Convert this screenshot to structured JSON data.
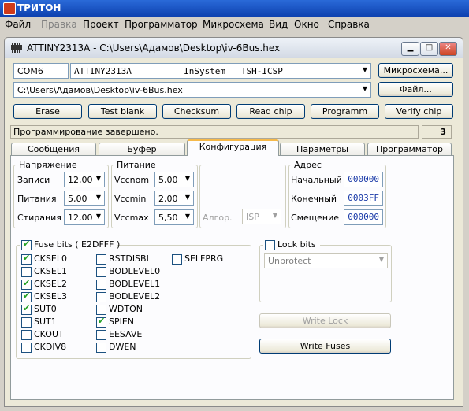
{
  "app": {
    "title": "ТРИТОН"
  },
  "menu": [
    {
      "label": "Файл",
      "disabled": false
    },
    {
      "label": "Правка",
      "disabled": true
    },
    {
      "label": "Проект",
      "disabled": false
    },
    {
      "label": "Программатор",
      "disabled": false
    },
    {
      "label": "Микросхема",
      "disabled": false
    },
    {
      "label": "Вид",
      "disabled": false
    },
    {
      "label": "Окно",
      "disabled": false
    },
    {
      "label": "Справка",
      "disabled": false
    }
  ],
  "window": {
    "title": "ATTINY2313A - C:\\Users\\Адамов\\Desktop\\iv-6Bus.hex"
  },
  "selectors": {
    "port": "COM6",
    "chip_info": "ATTINY2313A          InSystem   TSH-ICSP",
    "file_path": "C:\\Users\\Адамов\\Desktop\\iv-6Bus.hex",
    "chip_button": "Микросхема...",
    "file_button": "Файл..."
  },
  "actions": [
    "Erase",
    "Test blank",
    "Checksum",
    "Read chip",
    "Programm",
    "Verify chip"
  ],
  "status": {
    "text": "Программирование завершено.",
    "count": "3"
  },
  "tabs": [
    {
      "label": "Сообщения",
      "active": false
    },
    {
      "label": "Буфер",
      "active": false
    },
    {
      "label": "Конфигурация",
      "active": true
    },
    {
      "label": "Параметры",
      "active": false
    },
    {
      "label": "Программатор",
      "active": false
    }
  ],
  "voltage": {
    "label": "Напряжение",
    "rows": [
      {
        "label": "Записи",
        "value": "12,00"
      },
      {
        "label": "Питания",
        "value": "5,00"
      },
      {
        "label": "Стирания",
        "value": "12,00"
      }
    ]
  },
  "power": {
    "label": "Питание",
    "rows": [
      {
        "label": "Vccnom",
        "value": "5,00"
      },
      {
        "label": "Vccmin",
        "value": "2,00"
      },
      {
        "label": "Vccmax",
        "value": "5,50"
      }
    ]
  },
  "algo": {
    "label": "Алгор.",
    "value": "ISP"
  },
  "address": {
    "label": "Адрес",
    "rows": [
      {
        "label": "Начальный",
        "value": "000000"
      },
      {
        "label": "Конечный",
        "value": "0003FF"
      },
      {
        "label": "Смещение",
        "value": "000000"
      }
    ]
  },
  "fuse": {
    "label": "Fuse bits  ( E2DFFF )",
    "checked": true,
    "col1": [
      {
        "label": "CKSEL0",
        "checked": true
      },
      {
        "label": "CKSEL1",
        "checked": false
      },
      {
        "label": "CKSEL2",
        "checked": true
      },
      {
        "label": "CKSEL3",
        "checked": true
      },
      {
        "label": "SUT0",
        "checked": true
      },
      {
        "label": "SUT1",
        "checked": false
      },
      {
        "label": "CKOUT",
        "checked": false
      },
      {
        "label": "CKDIV8",
        "checked": false
      }
    ],
    "col2": [
      {
        "label": "RSTDISBL",
        "checked": false
      },
      {
        "label": "BODLEVEL0",
        "checked": false
      },
      {
        "label": "BODLEVEL1",
        "checked": false
      },
      {
        "label": "BODLEVEL2",
        "checked": false
      },
      {
        "label": "WDTON",
        "checked": false
      },
      {
        "label": "SPIEN",
        "checked": true
      },
      {
        "label": "EESAVE",
        "checked": false
      },
      {
        "label": "DWEN",
        "checked": false
      }
    ],
    "col3": [
      {
        "label": "SELFPRG",
        "checked": false
      }
    ]
  },
  "lock": {
    "label": "Lock bits",
    "checked": false,
    "select": "Unprotect"
  },
  "buttons": {
    "write_lock": "Write Lock",
    "write_fuses": "Write Fuses"
  }
}
